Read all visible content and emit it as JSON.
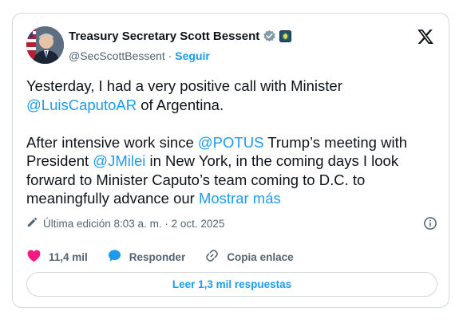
{
  "author": {
    "display_name": "Treasury Secretary Scott Bessent",
    "handle": "@SecScottBessent",
    "separator": "·",
    "follow_label": "Seguir"
  },
  "tweet": {
    "p1_start": "Yesterday, I had a very positive call with Minister ",
    "p1_mention": "@LuisCaputoAR",
    "p1_end": " of Argentina.",
    "p2_a": "After intensive work since ",
    "p2_mention1": "@POTUS",
    "p2_b": " Trump’s meeting with President ",
    "p2_mention2": "@JMilei",
    "p2_c": " in New York, in the coming days I look forward to Minister Caputo’s team coming to D.C. to meaningfully advance our ",
    "show_more": "Mostrar más"
  },
  "meta": {
    "edited_text": "Última edición 8:03 a. m. · 2 oct. 2025"
  },
  "actions": {
    "likes": "11,4 mil",
    "reply_label": "Responder",
    "copy_link_label": "Copia enlace"
  },
  "replies_button": "Leer 1,3 mil respuestas",
  "icons": {
    "verified": "verified-badge-icon",
    "gov": "government-affiliation-icon",
    "x_logo": "x-logo-icon",
    "edit": "pencil-icon",
    "info": "info-icon",
    "like": "heart-icon",
    "reply": "speech-bubble-icon",
    "link": "link-icon"
  },
  "colors": {
    "link": "#1d9bf0",
    "like": "#f91880",
    "text": "#0f1419",
    "secondary": "#536471"
  }
}
